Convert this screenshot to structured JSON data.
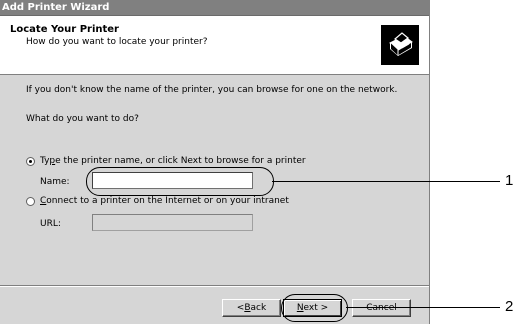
{
  "window": {
    "title": "Add Printer Wizard"
  },
  "header": {
    "title": "Locate Your Printer",
    "subtitle": "How do you want to locate your printer?"
  },
  "body": {
    "intro": "If you don't know the name of the printer, you can browse for one on the network.",
    "question": "What do you want to do?",
    "option1": {
      "pre": "Ty",
      "ul": "p",
      "post": "e the printer name, or click Next to browse for a printer",
      "selected": true
    },
    "name_label": "Name:",
    "name_value": "",
    "option2": {
      "ul": "C",
      "post": "onnect to a printer on the Internet or on your intranet",
      "selected": false
    },
    "url_label": "URL:",
    "url_value": ""
  },
  "buttons": {
    "back": {
      "pre": "< ",
      "ul": "B",
      "post": "ack"
    },
    "next": {
      "ul": "N",
      "post": "ext >"
    },
    "cancel": "Cancel"
  },
  "callouts": {
    "one": "1",
    "two": "2"
  },
  "icons": {
    "header": "printer-icon"
  }
}
